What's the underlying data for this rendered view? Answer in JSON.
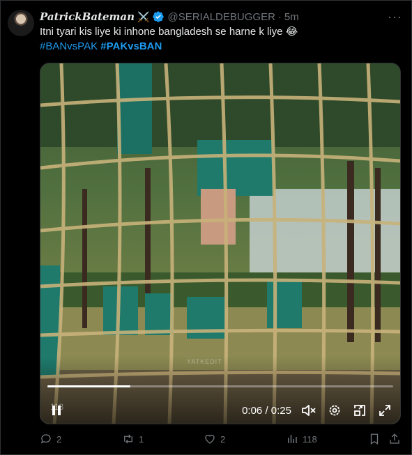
{
  "tweet": {
    "display_name": "PatrickBateman",
    "name_emoji": "⚔️",
    "handle": "@SERIALDEBUGGER",
    "separator": "·",
    "time": "5m",
    "text": "Itni tyari kis liye ki inhone bangladesh se harne k liye",
    "text_emoji": "😂",
    "hashtags": [
      "#BANvsPAK",
      "#PAKvsBAN"
    ],
    "more_label": "···"
  },
  "video": {
    "watermark": "YATKEDIT",
    "view_overlay": "118",
    "current_time": "0:06",
    "time_separator": " / ",
    "duration": "0:25",
    "progress": 0.24
  },
  "actions": {
    "replies": "2",
    "retweets": "1",
    "likes": "2",
    "views": "118"
  },
  "colors": {
    "background": "#000000",
    "text": "#e7e9ea",
    "muted": "#71767b",
    "link": "#1d9bf0",
    "verified": "#1d9bf0"
  }
}
